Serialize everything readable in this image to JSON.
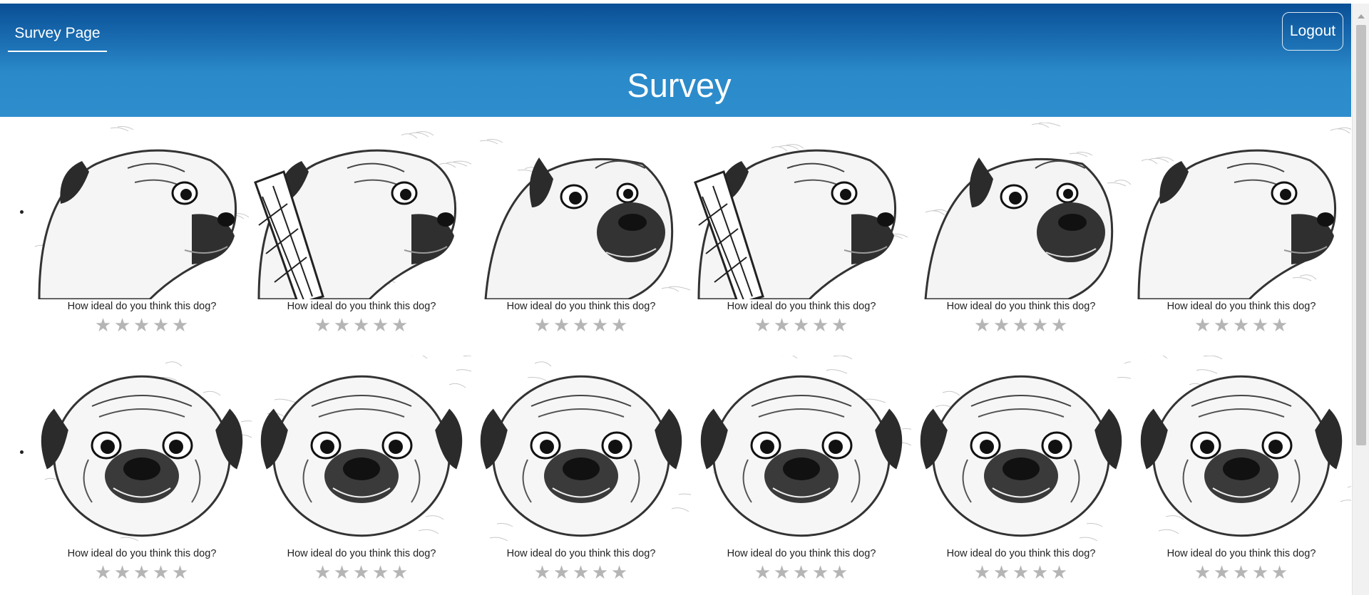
{
  "nav": {
    "survey_page_label": "Survey Page",
    "logout_label": "Logout"
  },
  "header": {
    "title": "Survey"
  },
  "question_text": "How ideal do you think this dog?",
  "star_glyph": "★",
  "items": [
    {
      "question": "How ideal do you think this dog?",
      "rating": 0,
      "pose": "profile-right"
    },
    {
      "question": "How ideal do you think this dog?",
      "rating": 0,
      "pose": "profile-right-collar"
    },
    {
      "question": "How ideal do you think this dog?",
      "rating": 0,
      "pose": "three-quarter"
    },
    {
      "question": "How ideal do you think this dog?",
      "rating": 0,
      "pose": "profile-right-collar"
    },
    {
      "question": "How ideal do you think this dog?",
      "rating": 0,
      "pose": "three-quarter"
    },
    {
      "question": "How ideal do you think this dog?",
      "rating": 0,
      "pose": "profile-right"
    },
    {
      "question": "How ideal do you think this dog?",
      "rating": 0,
      "pose": "frontal"
    },
    {
      "question": "How ideal do you think this dog?",
      "rating": 0,
      "pose": "frontal"
    },
    {
      "question": "How ideal do you think this dog?",
      "rating": 0,
      "pose": "frontal"
    },
    {
      "question": "How ideal do you think this dog?",
      "rating": 0,
      "pose": "frontal"
    },
    {
      "question": "How ideal do you think this dog?",
      "rating": 0,
      "pose": "frontal"
    },
    {
      "question": "How ideal do you think this dog?",
      "rating": 0,
      "pose": "frontal"
    }
  ],
  "colors": {
    "header_top": "#0a4f96",
    "header_bottom": "#2e8ecd",
    "star_empty": "#b5b5b5"
  }
}
